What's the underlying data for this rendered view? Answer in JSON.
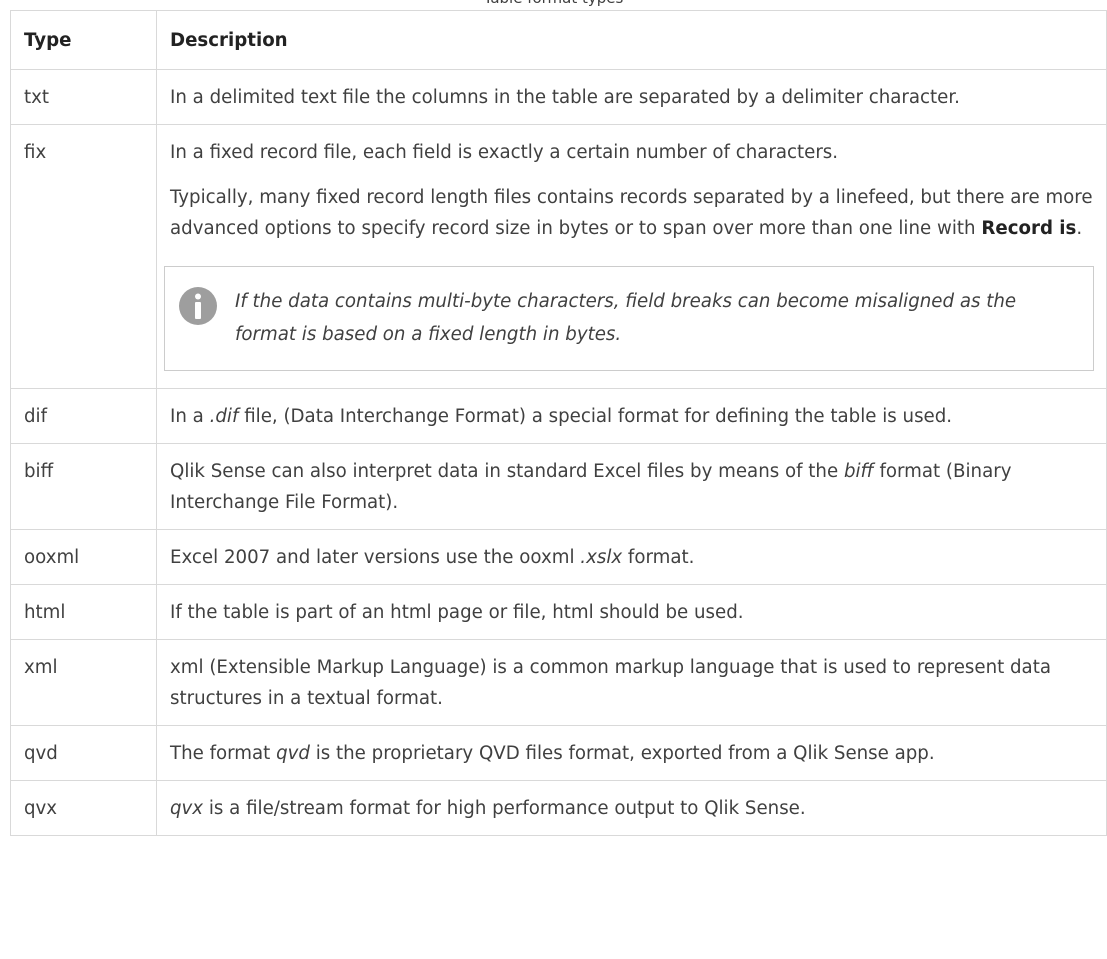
{
  "caption": "Table format types",
  "headers": {
    "type": "Type",
    "description": "Description"
  },
  "rows": {
    "txt": {
      "type": "txt",
      "desc": "In a delimited text file the columns in the table are separated by a delimiter character."
    },
    "fix": {
      "type": "fix",
      "p1": "In a fixed record file, each field is exactly a certain number of characters.",
      "p2_pre": "Typically, many fixed record length files contains records separated by a linefeed, but there are more advanced options to specify record size in bytes or to span over more than one line with ",
      "p2_bold": "Record is",
      "p2_post": ".",
      "note": "If the data contains multi-byte characters, field breaks can become misaligned as the format is based on a fixed length in bytes.",
      "note_icon": "info-icon"
    },
    "dif": {
      "type": "dif",
      "pre": "In a ",
      "ital": ".dif",
      "post": " file, (Data Interchange Format) a special format for defining the table is used."
    },
    "biff": {
      "type": "biff",
      "pre": "Qlik Sense can also interpret data in standard Excel files by means of the ",
      "ital": "biff",
      "post": " format (Binary Interchange File Format)."
    },
    "ooxml": {
      "type": "ooxml",
      "pre": "Excel 2007 and later versions use the ooxml ",
      "ital": ".xslx",
      "post": " format."
    },
    "html": {
      "type": "html",
      "desc": "If the table is part of an html page or file, html should be used."
    },
    "xml": {
      "type": "xml",
      "desc": "xml (Extensible Markup Language) is a common markup language that is used to represent data structures in a textual format."
    },
    "qvd": {
      "type": "qvd",
      "pre": "The format ",
      "ital": "qvd",
      "post": " is the proprietary QVD files format, exported from a Qlik Sense app."
    },
    "qvx": {
      "type": "qvx",
      "ital": "qvx",
      "post": " is a file/stream format for high performance output to Qlik Sense."
    }
  },
  "colors": {
    "border": "#d9d9d9",
    "text": "#404040",
    "icon": "#9e9e9e"
  }
}
